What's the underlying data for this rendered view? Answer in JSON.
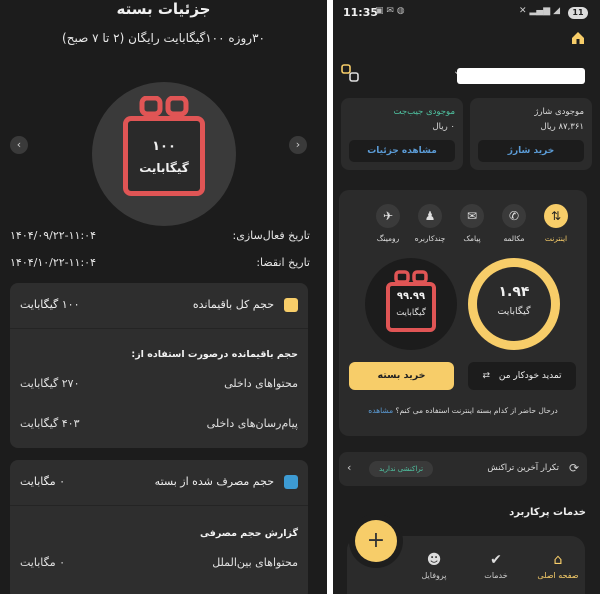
{
  "package_details": {
    "title": "جزئیات بسته",
    "subtitle": "۳۰روزه ۱۰۰گیگابایت رایگان (۲ تا ۷ صبح)",
    "gift": {
      "value": "۱۰۰",
      "unit": "گیگابایت"
    },
    "prev_arrow": "‹",
    "next_arrow": "›",
    "activation": {
      "label": "تاریخ فعال‌سازی:",
      "value": "۱۴۰۴/۰۹/۲۲-۱۱:۰۴"
    },
    "expiry": {
      "label": "تاریخ انقضا:",
      "value": "۱۴۰۴/۱۰/۲۲-۱۱:۰۴"
    },
    "remaining_card": {
      "label": "حجم کل باقیمانده",
      "value": "۱۰۰ گیگابایت",
      "color": "#f7cd69",
      "section_title": "حجم باقیمانده درصورت استفاده از:",
      "rows": [
        {
          "label": "محتواهای داخلی",
          "value": "۲۷۰ گیگابایت"
        },
        {
          "label": "پیام‌رسان‌های داخلی",
          "value": "۴۰۳ گیگابایت"
        }
      ]
    },
    "used_card": {
      "label": "حجم مصرف شده از بسته",
      "value": "۰ مگابایت",
      "color": "#3d9bd3",
      "section_title": "گزارش حجم مصرفی",
      "rows": [
        {
          "label": "محتواهای بین‌الملل",
          "value": "۰ مگابایت"
        }
      ]
    }
  },
  "home": {
    "status": {
      "time": "11:35",
      "battery": "11"
    },
    "wallet": {
      "title": "موجودی جیب‌جت",
      "value": "۰ ریال",
      "button": "مشاهده جزئیات",
      "title_color": "#4fc3a1"
    },
    "charge": {
      "title": "موجودی شارژ",
      "value": "۸۷,۳۶۱ ریال",
      "button": "خرید شارژ"
    },
    "services": [
      {
        "label": "اینترنت",
        "icon": "internet-icon",
        "glyph": "⇅"
      },
      {
        "label": "مکالمه",
        "icon": "phone-icon",
        "glyph": "✆"
      },
      {
        "label": "پیامک",
        "icon": "sms-icon",
        "glyph": "✉"
      },
      {
        "label": "چندکاربره",
        "icon": "multi-user-icon",
        "glyph": "♟"
      },
      {
        "label": "رومینگ",
        "icon": "roaming-icon",
        "glyph": "✈"
      }
    ],
    "usage_ring": {
      "value": "۱.۹۴",
      "unit": "گیگابایت",
      "color": "#f7cd69"
    },
    "gift_circle": {
      "value": "۹۹.۹۹",
      "unit": "گیگابایت"
    },
    "buy_button": "خرید بسته",
    "auto_renew_button": "تمدید خودکار من",
    "question": "درحال حاضر از کدام بسته اینترنت استفاده می کنم؟",
    "question_link": "مشاهده",
    "last_tx": {
      "label": "تکرار آخرین تراکنش",
      "badge": "تراکنشی ندارید"
    },
    "section_title": "خدمات پرکاربرد",
    "tabs": [
      {
        "label": "صفحه اصلی",
        "glyph": "⌂",
        "active": true
      },
      {
        "label": "خدمات",
        "glyph": "✔",
        "active": false
      },
      {
        "label": "پروفایل",
        "glyph": "☻",
        "active": false
      }
    ],
    "fab": "+"
  }
}
